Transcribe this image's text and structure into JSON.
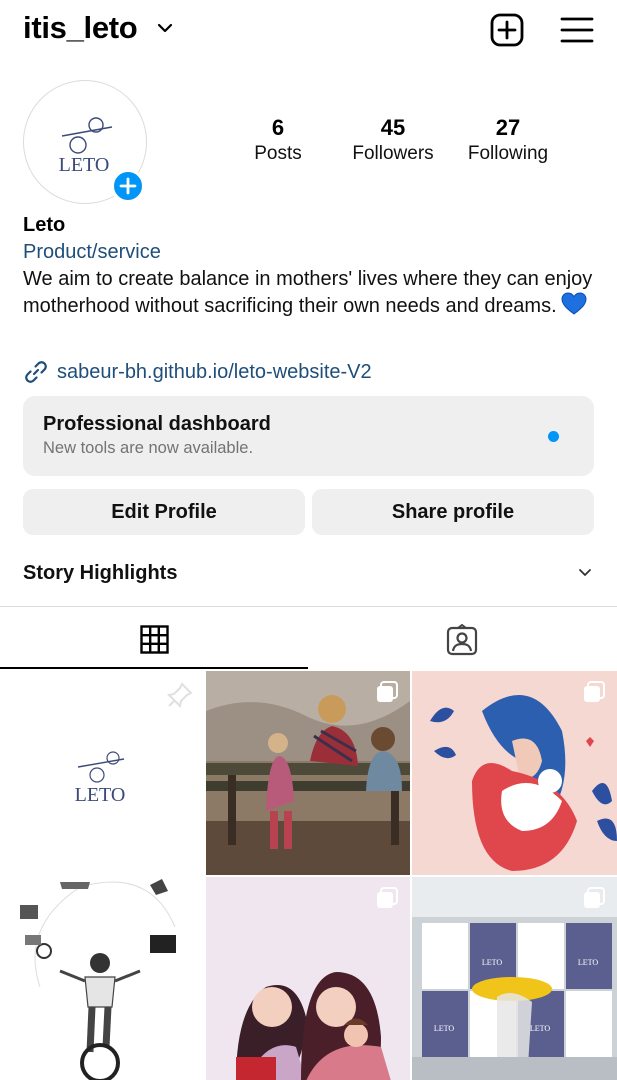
{
  "header": {
    "username": "itis_leto"
  },
  "profile": {
    "logo_text": "LETO",
    "stats": {
      "posts": {
        "value": "6",
        "label": "Posts"
      },
      "followers": {
        "value": "45",
        "label": "Followers"
      },
      "following": {
        "value": "27",
        "label": "Following"
      }
    },
    "name": "Leto",
    "category": "Product/service",
    "bio": "We aim to create balance in mothers' lives where they can enjoy motherhood without sacrificing their own needs and dreams.",
    "link": "sabeur-bh.github.io/leto-website-V2"
  },
  "dashboard": {
    "title": "Professional dashboard",
    "subtitle": "New tools are now available."
  },
  "buttons": {
    "edit": "Edit Profile",
    "share": "Share profile"
  },
  "highlights": {
    "label": "Story Highlights"
  },
  "posts": {
    "logo_text": "LETO",
    "poster_text": "LETO"
  },
  "colors": {
    "accent_blue": "#0095f6",
    "link_blue": "#1f4e79",
    "button_gray": "#efefef"
  }
}
